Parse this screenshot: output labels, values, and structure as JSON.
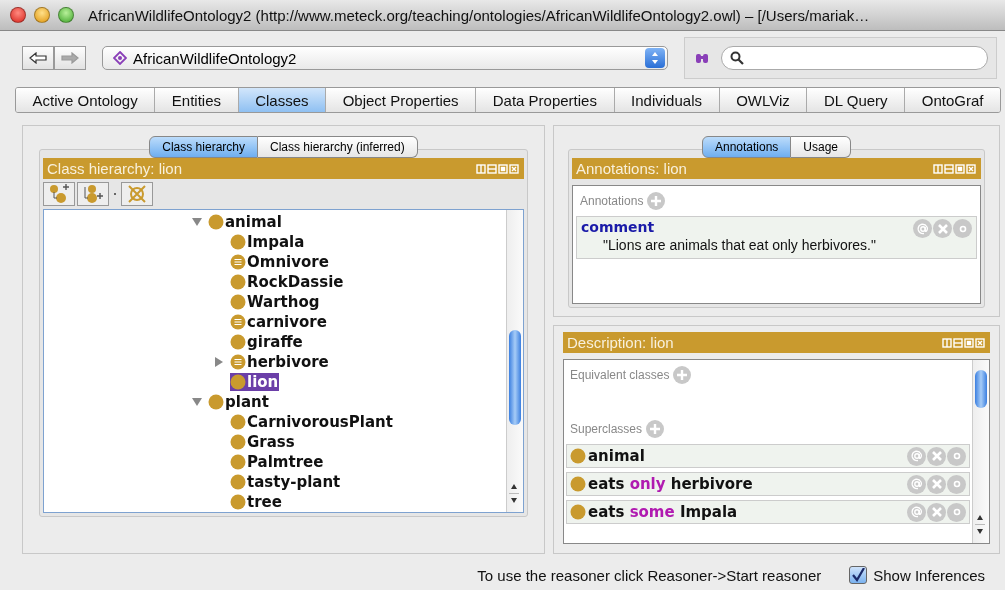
{
  "window": {
    "title": "AfricanWildlifeOntology2 (http://www.meteck.org/teaching/ontologies/AfricanWildlifeOntology2.owl) – [/Users/mariak…"
  },
  "toolbar": {
    "nav": [
      {
        "kind": "back",
        "disabled": false
      },
      {
        "kind": "forward",
        "disabled": true
      }
    ],
    "ontology": "AfricanWildlifeOntology2"
  },
  "tabs": [
    {
      "label": "Active Ontology",
      "selected": false
    },
    {
      "label": "Entities",
      "selected": false
    },
    {
      "label": "Classes",
      "selected": true
    },
    {
      "label": "Object Properties",
      "selected": false
    },
    {
      "label": "Data Properties",
      "selected": false
    },
    {
      "label": "Individuals",
      "selected": false
    },
    {
      "label": "OWLViz",
      "selected": false
    },
    {
      "label": "DL Query",
      "selected": false
    },
    {
      "label": "OntoGraf",
      "selected": false
    }
  ],
  "class_panel": {
    "subtabs": [
      {
        "label": "Class hierarchy",
        "selected": true
      },
      {
        "label": "Class hierarchy (inferred)",
        "selected": false
      }
    ],
    "header": "Class hierarchy: lion",
    "tree": [
      {
        "label": "animal",
        "kind": "class",
        "expanded": true,
        "selected": false,
        "children": [
          {
            "label": "Impala",
            "kind": "class",
            "selected": false
          },
          {
            "label": "Omnivore",
            "kind": "defined",
            "selected": false
          },
          {
            "label": "RockDassie",
            "kind": "class",
            "selected": false
          },
          {
            "label": "Warthog",
            "kind": "class",
            "selected": false
          },
          {
            "label": "carnivore",
            "kind": "defined",
            "selected": false
          },
          {
            "label": "giraffe",
            "kind": "class",
            "selected": false
          },
          {
            "label": "herbivore",
            "kind": "defined",
            "expanded": false,
            "selected": false
          },
          {
            "label": "lion",
            "kind": "class",
            "selected": true
          }
        ]
      },
      {
        "label": "plant",
        "kind": "class",
        "expanded": true,
        "selected": false,
        "children": [
          {
            "label": "CarnivorousPlant",
            "kind": "class",
            "selected": false
          },
          {
            "label": "Grass",
            "kind": "class",
            "selected": false
          },
          {
            "label": "Palmtree",
            "kind": "class",
            "selected": false
          },
          {
            "label": "tasty-plant",
            "kind": "class",
            "selected": false
          },
          {
            "label": "tree",
            "kind": "class",
            "selected": false
          }
        ]
      }
    ]
  },
  "annotations_panel": {
    "subtabs": [
      {
        "label": "Annotations",
        "selected": true
      },
      {
        "label": "Usage",
        "selected": false
      }
    ],
    "header": "Annotations: lion",
    "section": "Annotations",
    "annotations": [
      {
        "property": "comment",
        "value": "\"Lions are animals that eat only herbivores.\""
      }
    ]
  },
  "description_panel": {
    "header": "Description: lion",
    "sections": [
      {
        "title": "Equivalent classes"
      },
      {
        "title": "Superclasses",
        "items": [
          [
            {
              "text": "animal",
              "kind": "name"
            }
          ],
          [
            {
              "text": "eats",
              "kind": "name"
            },
            {
              "text": "only",
              "kind": "keyword"
            },
            {
              "text": "herbivore",
              "kind": "name"
            }
          ],
          [
            {
              "text": "eats",
              "kind": "name"
            },
            {
              "text": "some",
              "kind": "keyword"
            },
            {
              "text": "Impala",
              "kind": "name"
            }
          ]
        ]
      }
    ]
  },
  "status_bar": {
    "message": "To use the reasoner click Reasoner->Start reasoner",
    "show_inferences": {
      "label": "Show Inferences",
      "checked": true
    }
  }
}
